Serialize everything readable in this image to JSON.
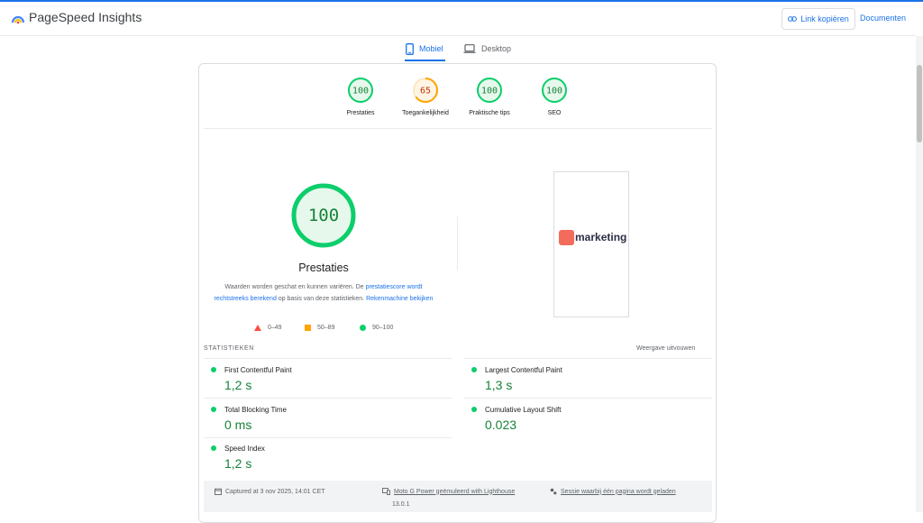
{
  "header": {
    "brand": "PageSpeed Insights",
    "copy_link_label": "Link kopiëren",
    "docs_label": "Documenten"
  },
  "tabs": [
    {
      "label": "Mobiel",
      "icon": "smartphone-icon",
      "active": true
    },
    {
      "label": "Desktop",
      "icon": "laptop-icon",
      "active": false
    }
  ],
  "scores": [
    {
      "value": "100",
      "label": "Prestaties",
      "color": "#0cce6b"
    },
    {
      "value": "65",
      "label": "Toegankelijkheid",
      "color": "#ffa400"
    },
    {
      "value": "100",
      "label": "Praktische tips",
      "color": "#0cce6b"
    },
    {
      "value": "100",
      "label": "SEO",
      "color": "#0cce6b"
    }
  ],
  "performance": {
    "score": "100",
    "title": "Prestaties",
    "desc_1": "Waarden worden geschat en kunnen variëren. De ",
    "desc_link_1": "prestatiescore wordt rechtstreeks berekend",
    "desc_2": " op basis van deze statistieken. ",
    "desc_link_2": "Rekenmachine bekijken"
  },
  "legend": [
    {
      "range": "0–49",
      "shape": "triangle",
      "color": "#ff4e42"
    },
    {
      "range": "50–89",
      "shape": "square",
      "color": "#ffa400"
    },
    {
      "range": "90–100",
      "shape": "circle",
      "color": "#0cce6b"
    }
  ],
  "screenshot": {
    "brand_text": "marketing"
  },
  "stats": {
    "heading": "STATISTIEKEN",
    "expand_label": "Weergave uitvouwen",
    "metrics": [
      {
        "name": "First Contentful Paint",
        "value": "1,2 s"
      },
      {
        "name": "Largest Contentful Paint",
        "value": "1,3 s"
      },
      {
        "name": "Total Blocking Time",
        "value": "0 ms"
      },
      {
        "name": "Cumulative Layout Shift",
        "value": "0.023"
      },
      {
        "name": "Speed Index",
        "value": "1,2 s"
      }
    ]
  },
  "footer": {
    "captured": "Captured at 3 nov 2025, 14:01 CET",
    "device": "Moto G Power geëmuleerd with Lighthouse",
    "version": "13.0.1",
    "session": "Sessie waarbij één pagina wordt geladen"
  },
  "colors": {
    "accent": "#1a73e8",
    "pass": "#0cce6b",
    "average": "#ffa400",
    "fail": "#ff4e42",
    "pass_text": "#178239"
  }
}
